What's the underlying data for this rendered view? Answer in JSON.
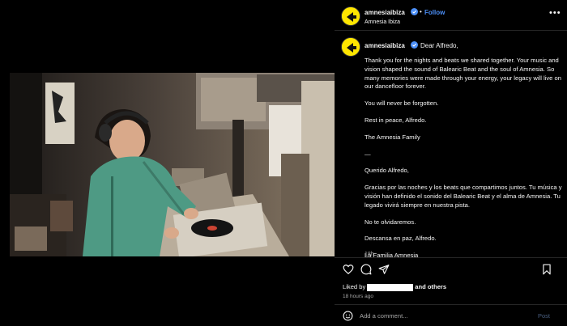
{
  "header": {
    "username": "amnesiaibiza",
    "separator": "•",
    "follow_label": "Follow",
    "location": "Amnesia Ibiza",
    "more_icon": "more-horizontal-icon"
  },
  "caption": {
    "username": "amnesiaibiza",
    "first_line": "Dear Alfredo,",
    "paragraphs": [
      "Thank you for the nights and beats we shared together. Your music and vision shaped the sound of Balearic Beat and the soul of Amnesia. So many memories were made through your energy, your legacy will live on our dancefloor forever.",
      "You will never be forgotten.",
      "Rest in peace, Alfredo.",
      "The Amnesia Family",
      "—",
      "Querido Alfredo,",
      "Gracias por las noches y los beats que compartimos juntos. Tu música y visión han definido el sonido del Balearic Beat y el alma de Amnesia. Tu legado vivirá siempre en nuestra pista.",
      "No te olvidaremos.",
      "Descansa en paz, Alfredo.",
      "La Familia Amnesia"
    ],
    "time": "18h"
  },
  "actions": {
    "liked_by_prefix": "Liked by",
    "and_others": "and others",
    "ago": "18 hours ago"
  },
  "comment": {
    "placeholder": "Add a comment...",
    "post_label": "Post"
  },
  "colors": {
    "accent": "#4c8ff7",
    "brand_yellow": "#ffe600",
    "muted": "#a8a8a8"
  }
}
